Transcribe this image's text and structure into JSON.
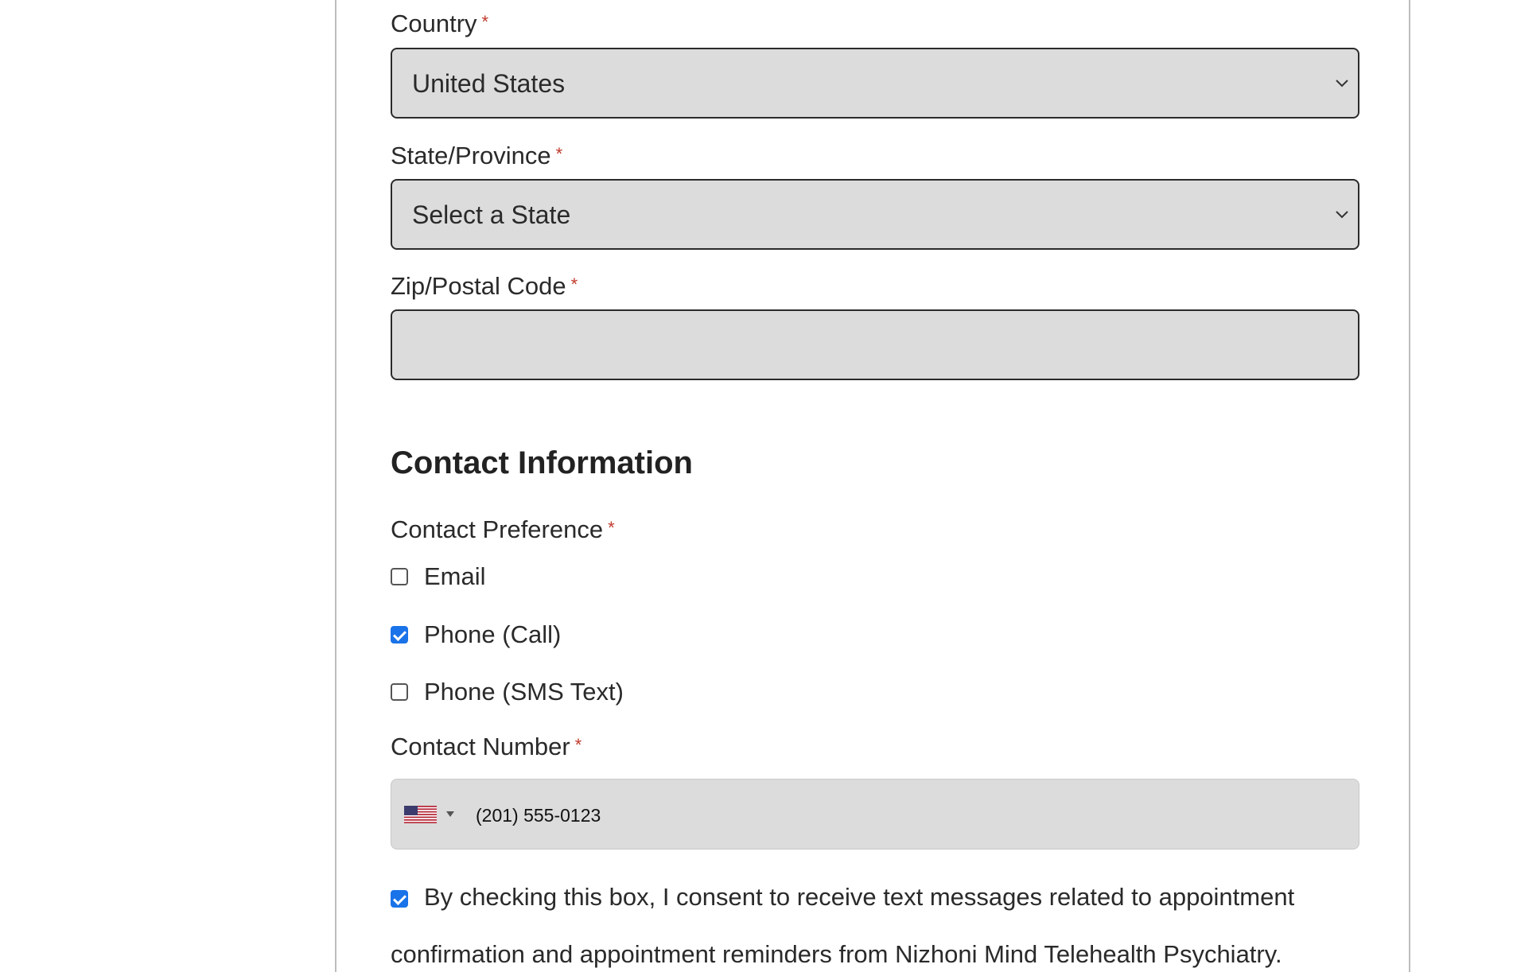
{
  "address": {
    "country": {
      "label": "Country",
      "required_mark": "*",
      "selected": "United States"
    },
    "state": {
      "label": "State/Province",
      "required_mark": "*",
      "selected": "Select a State"
    },
    "zip": {
      "label": "Zip/Postal Code",
      "required_mark": "*",
      "value": ""
    }
  },
  "contact": {
    "heading": "Contact Information",
    "preference": {
      "label": "Contact Preference",
      "required_mark": "*",
      "options": [
        {
          "label": "Email",
          "checked": false
        },
        {
          "label": "Phone (Call)",
          "checked": true
        },
        {
          "label": "Phone (SMS Text)",
          "checked": false
        }
      ]
    },
    "number": {
      "label": "Contact Number",
      "required_mark": "*",
      "country_flag": "us-flag-icon",
      "value": "(201) 555-0123"
    },
    "consent": {
      "checked": true,
      "text": "By checking this box, I consent to receive text messages related to appointment confirmation and appointment reminders from Nizhoni Mind Telehealth Psychiatry."
    }
  },
  "colors": {
    "field_bg": "#dcdcdc",
    "required": "#c0392b",
    "checkbox_checked": "#1a73e8"
  }
}
